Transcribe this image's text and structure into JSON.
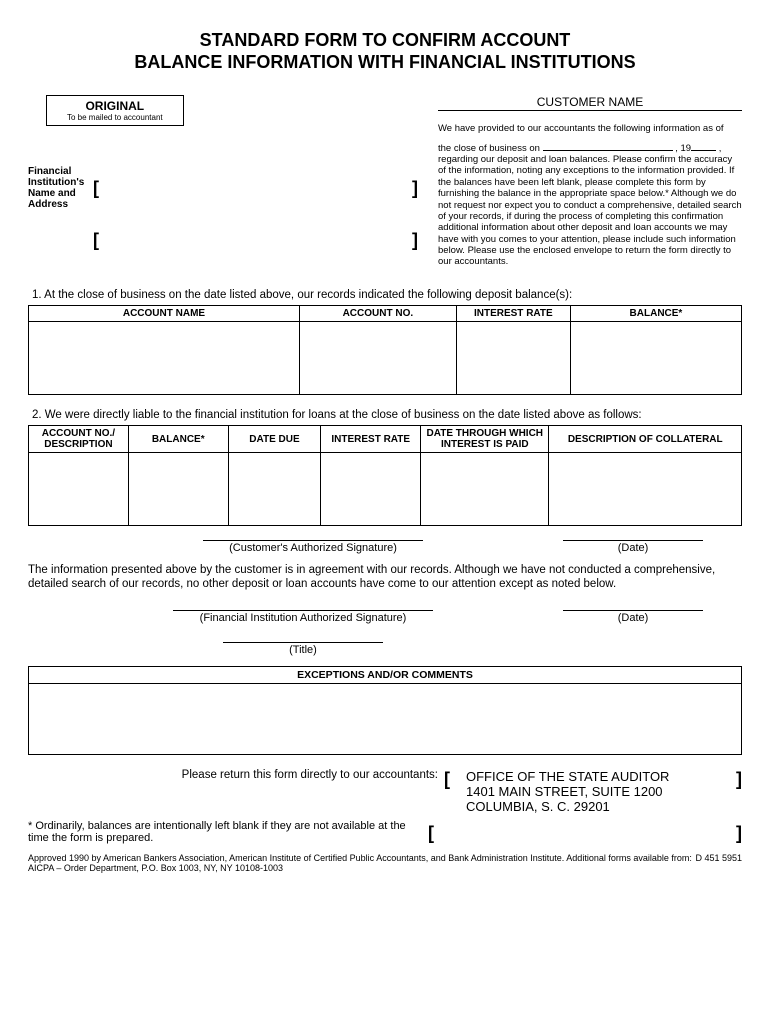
{
  "title_line1": "STANDARD FORM TO CONFIRM ACCOUNT",
  "title_line2": "BALANCE INFORMATION WITH FINANCIAL INSTITUTIONS",
  "original_box": {
    "label": "ORIGINAL",
    "sub": "To be mailed to accountant"
  },
  "fin_inst_label": "Financial Institution's Name and Address",
  "customer_name_label": "CUSTOMER NAME",
  "intro_line1": "We have provided to our accountants the following information as of",
  "intro_date_prefix": "the close of business on",
  "intro_year_prefix": ", 19",
  "intro_body": "regarding our deposit and loan balances. Please confirm the accuracy of the information, noting any exceptions to the information provided. If the balances have been left blank, please complete this form by furnishing the balance in the appropriate space below.* Although we do not request nor expect you to conduct a comprehensive, detailed search of your records, if during the process of completing this confirmation additional information about other deposit and loan accounts we may have with you comes to your attention, please include such information below. Please use the enclosed envelope to return the form directly to our accountants.",
  "section1_intro": "1.   At the close of business on the date listed above, our records indicated the following deposit balance(s):",
  "table1_headers": {
    "c1": "ACCOUNT NAME",
    "c2": "ACCOUNT NO.",
    "c3": "INTEREST RATE",
    "c4": "BALANCE*"
  },
  "section2_intro": "2.   We were directly liable to the financial institution for loans at the close of business on the date listed above as follows:",
  "table2_headers": {
    "c1": "ACCOUNT NO./ DESCRIPTION",
    "c2": "BALANCE*",
    "c3": "DATE DUE",
    "c4": "INTEREST RATE",
    "c5": "DATE THROUGH WHICH INTEREST IS PAID",
    "c6": "DESCRIPTION OF COLLATERAL"
  },
  "sig_customer": "(Customer's Authorized Signature)",
  "sig_date": "(Date)",
  "agreement_text": "The information presented above by the customer is in agreement with our records. Although we have not conducted a comprehensive, detailed search of our records, no other deposit or loan accounts have come to our attention except as noted below.",
  "sig_fin_inst": "(Financial Institution Authorized Signature)",
  "sig_title": "(Title)",
  "exceptions_header": "EXCEPTIONS AND/OR COMMENTS",
  "return_label": "Please return this form directly to our accountants:",
  "return_address": {
    "line1": "OFFICE OF THE STATE AUDITOR",
    "line2": "1401 MAIN STREET, SUITE 1200",
    "line3": "COLUMBIA, S. C. 29201"
  },
  "footnote": "* Ordinarily, balances are intentionally left blank if they are not available at the time the form is prepared.",
  "bottom_note": "Approved 1990 by American Bankers Association, American Institute of Certified Public Accountants, and Bank Administration Institute. Additional forms available from: AICPA – Order Department, P.O. Box 1003, NY, NY 10108-1003",
  "form_id": "D 451 5951"
}
